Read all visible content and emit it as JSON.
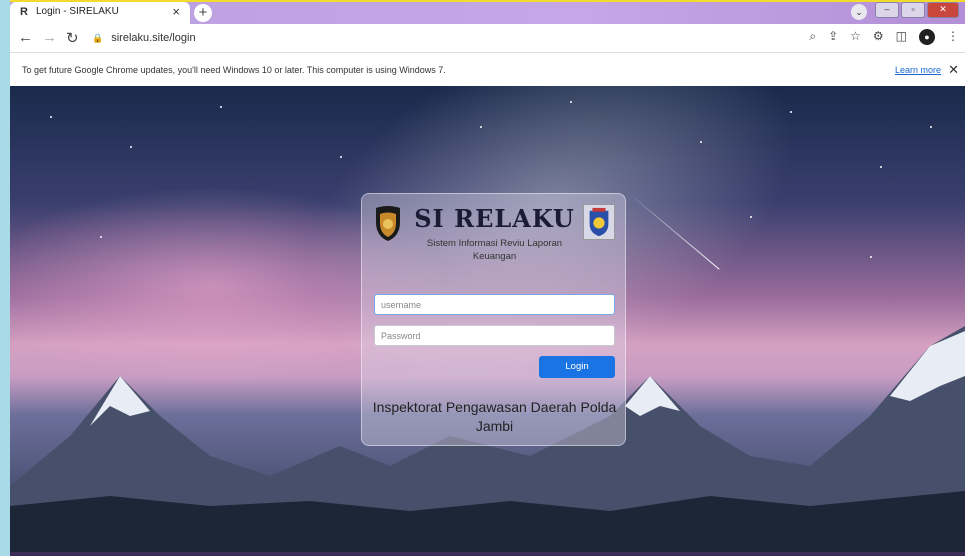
{
  "browser": {
    "tab_title": "Login - SIRELAKU",
    "tab_favicon": "R",
    "tab_close": "×",
    "new_tab": "+",
    "url": "sirelaku.site/login",
    "infobar_message": "To get future Google Chrome updates, you'll need Windows 10 or later. This computer is using Windows 7.",
    "infobar_link": "Learn more",
    "infobar_close": "✕"
  },
  "login": {
    "brand": "SI RELAKU",
    "subtitle": "Sistem Informasi Reviu Laporan Keuangan",
    "username_placeholder": "username",
    "password_placeholder": "Password",
    "login_button": "Login",
    "footer": "Inspektorat Pengawasan Daerah Polda Jambi"
  },
  "colors": {
    "accent": "#1b74e4",
    "card_bg": "rgba(220,215,235,0.38)"
  }
}
